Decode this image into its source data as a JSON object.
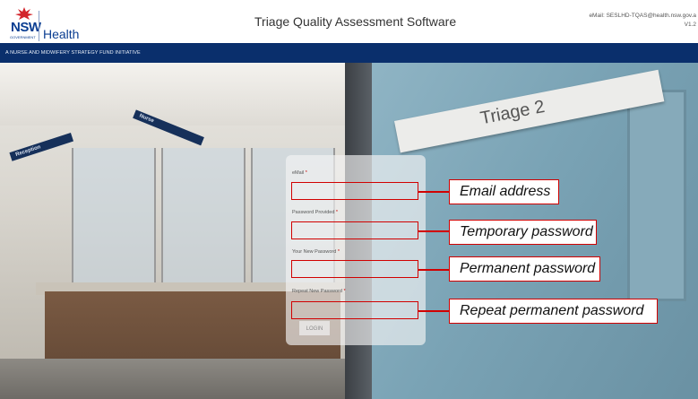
{
  "header": {
    "logo_nsw": "NSW",
    "logo_government": "GOVERNMENT",
    "logo_health": "Health",
    "app_title": "Triage Quality Assessment Software",
    "contact_email": "eMail: SESLHD-TQAS@health.nsw.gov.a",
    "version": "V1.2"
  },
  "banner": {
    "text": "A NURSE AND MIDWIFERY STRATEGY FUND INITIATIVE"
  },
  "scene": {
    "door_sign": "Triage 2",
    "signs": [
      "Reception",
      "Nurse"
    ]
  },
  "form": {
    "required_marker": "*",
    "fields": [
      {
        "label": "eMail",
        "value": "",
        "callout": "Email address"
      },
      {
        "label": "Password Provided",
        "value": "",
        "callout": "Temporary password"
      },
      {
        "label": "Your New Password",
        "value": "",
        "callout": "Permanent password"
      },
      {
        "label": "Repeat New Password",
        "value": "",
        "callout": "Repeat permanent password"
      }
    ],
    "login_button": "LOGIN"
  },
  "colors": {
    "brand_blue": "#0a2f6c",
    "highlight_red": "#d10000"
  }
}
